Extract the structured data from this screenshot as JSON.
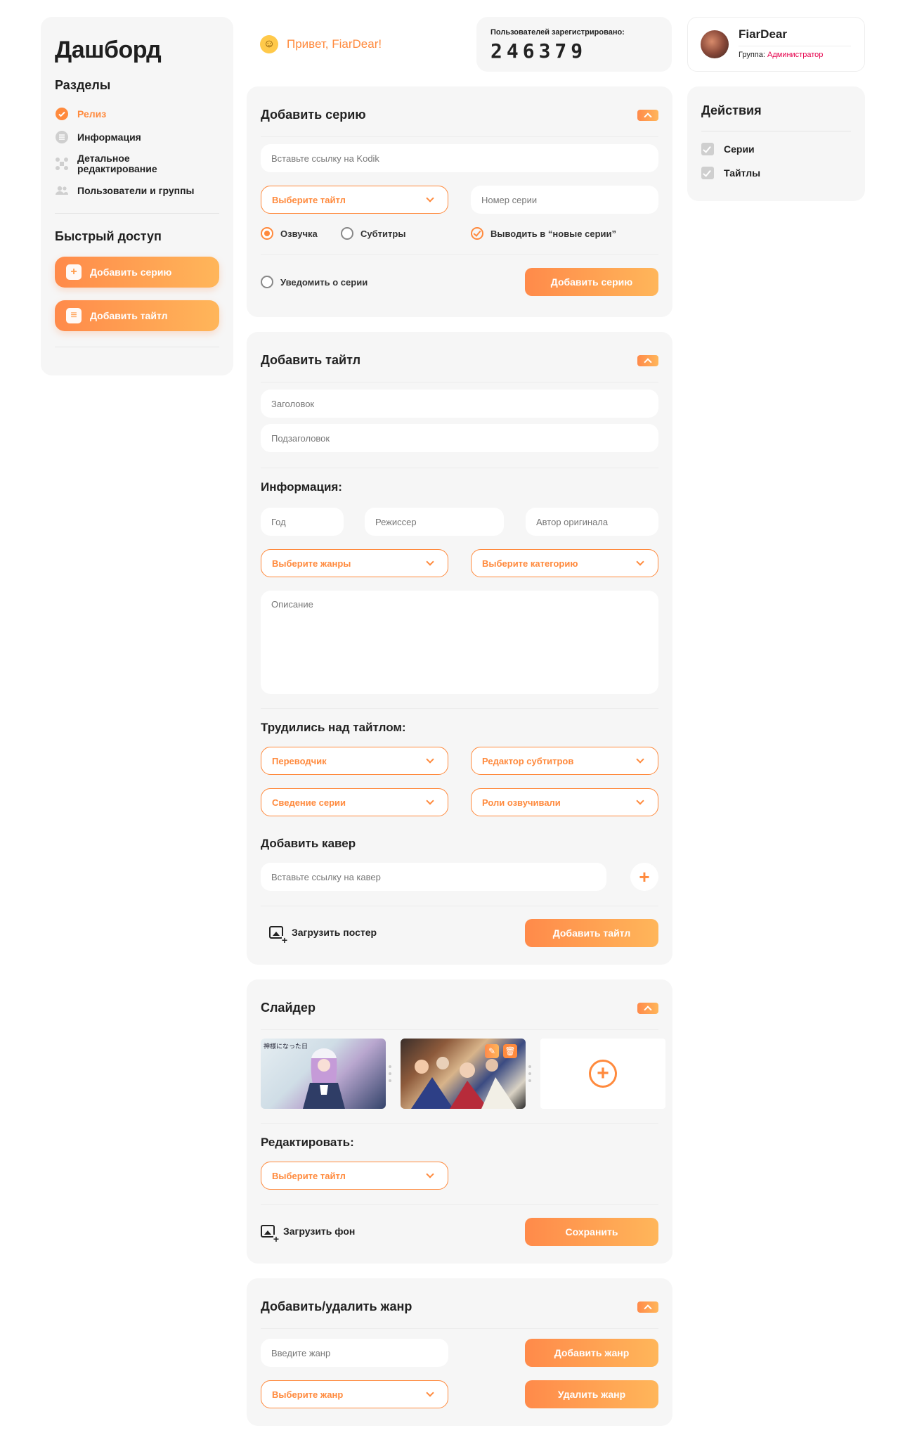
{
  "sidebar": {
    "title": "Дашборд",
    "sections_title": "Разделы",
    "nav": [
      {
        "label": "Релиз",
        "icon": "check-circle-icon",
        "active": true
      },
      {
        "label": "Информация",
        "icon": "list-icon"
      },
      {
        "label": "Детальное редактирование",
        "icon": "grid-icon"
      },
      {
        "label": "Пользователи и группы",
        "icon": "users-icon"
      }
    ],
    "quick_title": "Быстрый доступ",
    "quick": [
      {
        "label": "Добавить серию",
        "icon": "plus-box-icon"
      },
      {
        "label": "Добавить тайтл",
        "icon": "message-box-icon"
      }
    ]
  },
  "header": {
    "greeting": "Привет, FiarDear!",
    "users_label": "Пользователей зарегистрировано:",
    "users_count": "246379"
  },
  "profile": {
    "name": "FiarDear",
    "group_label": "Группа:",
    "group": "Администратор"
  },
  "actions": {
    "title": "Действия",
    "items": [
      "Серии",
      "Тайтлы"
    ]
  },
  "episode": {
    "title": "Добавить серию",
    "kodik_placeholder": "Вставьте ссылку на Kodik",
    "title_select": "Выберите тайтл",
    "number_placeholder": "Номер серии",
    "voice": "Озвучка",
    "subs": "Субтитры",
    "show_new": "Выводить в “новые серии”",
    "notify": "Уведомить о серии",
    "submit": "Добавить серию"
  },
  "title_form": {
    "title": "Добавить тайтл",
    "heading_placeholder": "Заголовок",
    "subheading_placeholder": "Подзаголовок",
    "info_title": "Информация:",
    "year_placeholder": "Год",
    "director_placeholder": "Режиссер",
    "author_placeholder": "Автор оригинала",
    "genres_select": "Выберите жанры",
    "category_select": "Выберите категорию",
    "description_placeholder": "Описание",
    "worked_title": "Трудились над тайтлом:",
    "translator": "Переводчик",
    "subs_editor": "Редактор субтитров",
    "mixing": "Сведение серии",
    "voice_roles": "Роли озвучивали",
    "cover_title": "Добавить кавер",
    "cover_placeholder": "Вставьте ссылку на кавер",
    "upload_poster": "Загрузить постер",
    "submit": "Добавить тайтл"
  },
  "slider": {
    "title": "Слайдер",
    "edit_title": "Редактировать:",
    "title_select": "Выберите тайтл",
    "upload_bg": "Загрузить фон",
    "save": "Сохранить",
    "slide1_caption": "神様になった日"
  },
  "genre": {
    "title": "Добавить/удалить жанр",
    "input_placeholder": "Введите жанр",
    "add": "Добавить жанр",
    "select": "Выберите жанр",
    "remove": "Удалить жанр"
  },
  "colors": {
    "accent": "#ff8a3d",
    "gradient_start": "#ff8a4a",
    "gradient_end": "#ffb65a",
    "role": "#e6004c",
    "card_bg": "#f6f6f6"
  }
}
